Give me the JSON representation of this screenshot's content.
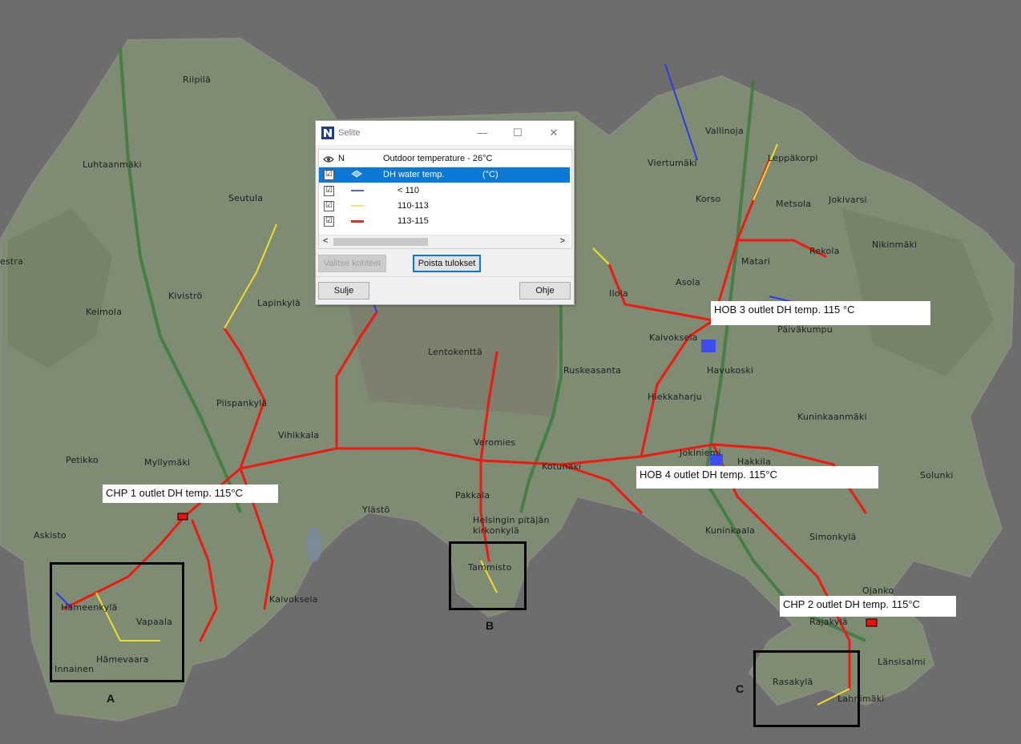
{
  "map": {
    "background_color": "#6d6d6d",
    "land_color": "#7f8c74",
    "network_colors": {
      "below_110": "#2f3ae0",
      "mid_110_113": "#f0dd2a",
      "high_113_115": "#f2170f"
    },
    "place_names": [
      "Riipilä",
      "Luhtaanmäki",
      "Seutula",
      "estra",
      "Keimola",
      "Kiviströ",
      "Lapinkylä",
      "Piispankylä",
      "Vihikkala",
      "Petikko",
      "Myllymäki",
      "Askisto",
      "Hämeenkylä",
      "Vapaala",
      "Hämevaara",
      "Innainen",
      "Kaivoksela",
      "Ylästö",
      "Lentokenttä",
      "Veromies",
      "Kotunaki",
      "Pakkala",
      "Helsingin pitäjän kirkonkylä",
      "Tammisto",
      "Ruskeasanta",
      "Hiekkaharju",
      "Jokiniemi",
      "Hakkila",
      "Ilola",
      "Kaivoksela",
      "Vallinoja",
      "Viertumäki",
      "Leppäkorpi",
      "Korso",
      "Metsola",
      "Jokivarsi",
      "Nikinmäki",
      "Matari",
      "Rekola",
      "Asola",
      "Päiväkumpu",
      "Havukoski",
      "Kuninkaanmäki",
      "Kuninkaala",
      "Simonkylä",
      "Solunki",
      "Ojanko",
      "Länsisalmi",
      "Rajakylä",
      "Rasakylä",
      "Lahnimäki"
    ],
    "callouts": {
      "chp1": "CHP 1 outlet DH temp. 115°C",
      "chp2": "CHP 2 outlet DH temp. 115°C",
      "hob3": "HOB 3 outlet DH temp. 115 °C",
      "hob4": "HOB 4 outlet DH temp. 115°C"
    },
    "zones": {
      "a": "A",
      "b": "B",
      "c": "C"
    }
  },
  "dialog": {
    "title": "Selite",
    "app_icon": "app-logo-icon",
    "controls": {
      "minimize": "—",
      "maximize": "☐",
      "close": "✕"
    },
    "header": {
      "visibility_icon": "eye-icon",
      "name_col": "N",
      "caption": "Outdoor temperature - 26°C"
    },
    "rows": [
      {
        "label": "DH water temp.",
        "unit": "(°C)",
        "checked": true,
        "selected": true,
        "icon": "layer-icon"
      },
      {
        "label": "< 110",
        "checked": true,
        "color": "#5a63e8"
      },
      {
        "label": "110-113",
        "checked": true,
        "color": "#f5e27a"
      },
      {
        "label": "113-115",
        "checked": true,
        "color": "#e0302a"
      }
    ],
    "check_glyph": "☑",
    "scroll": {
      "left": "<",
      "right": ">"
    },
    "buttons": {
      "select": "Valitse kohteet",
      "remove": "Poista tulokset",
      "close": "Sulje",
      "help": "Ohje"
    }
  }
}
